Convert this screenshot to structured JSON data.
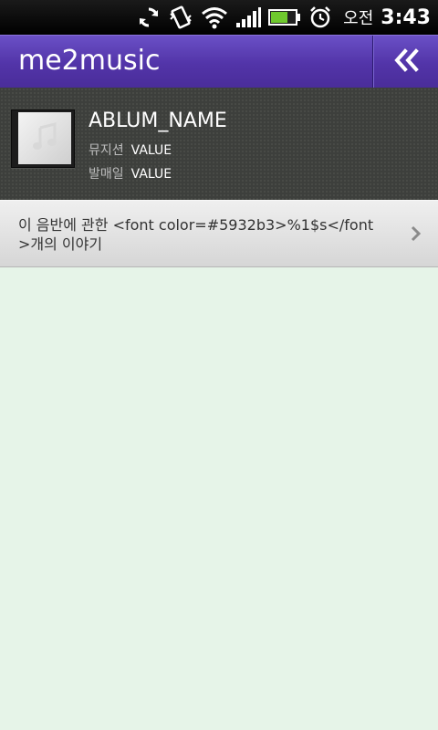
{
  "status_bar": {
    "ampm": "오전",
    "time": "3:43",
    "icons": [
      "sync-icon",
      "vibrate-icon",
      "wifi-icon",
      "signal-icon",
      "battery-icon",
      "alarm-icon"
    ]
  },
  "title_bar": {
    "title": "me2music",
    "back_icon": "double-chevron-left-icon",
    "background_color": "#5234a8"
  },
  "album": {
    "name": "ABLUM_NAME",
    "musician_label": "뮤지션",
    "musician_value": "VALUE",
    "release_label": "발매일",
    "release_value": "VALUE",
    "cover_icon": "music-note-icon"
  },
  "story": {
    "text": "이 음반에 관한 <font color=#5932b3>%1$s</font>개의 이야기",
    "chevron_icon": "chevron-right-icon"
  },
  "colors": {
    "content_background": "#e6f4e8",
    "header_background": "#3d3f3c"
  }
}
